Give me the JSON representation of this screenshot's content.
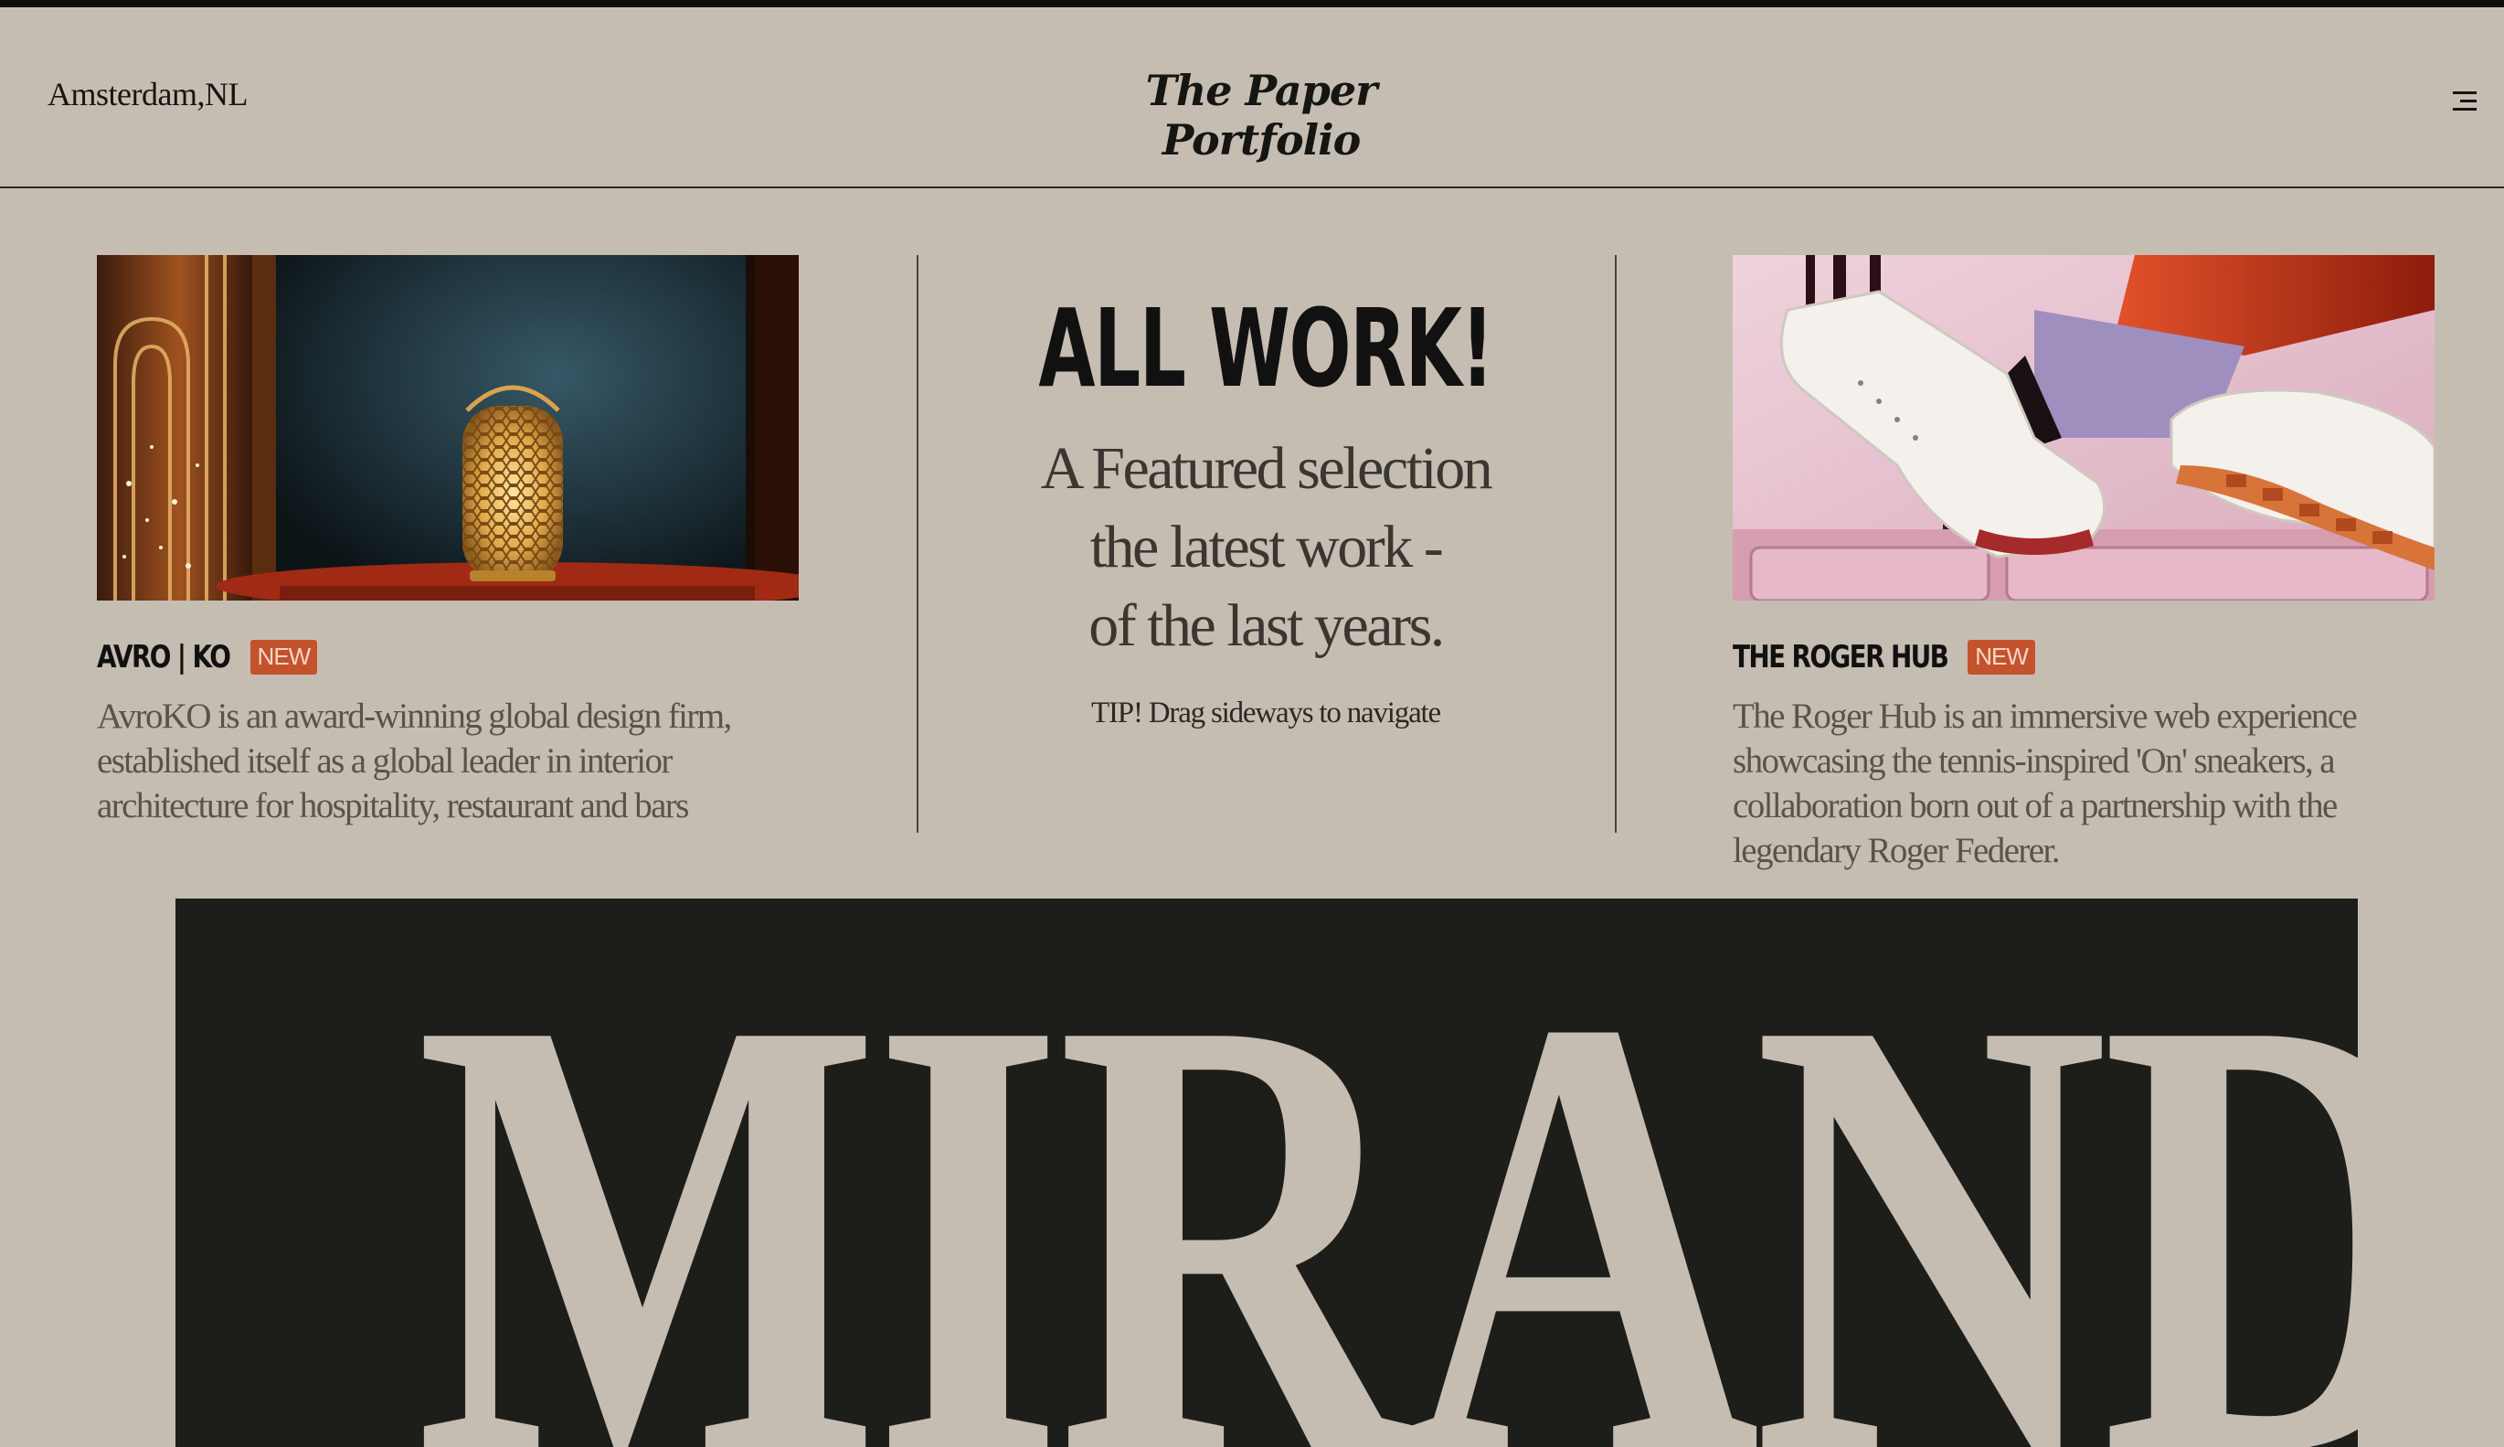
{
  "header": {
    "location": "Amsterdam,NL",
    "site_title": "The Paper Portfolio",
    "menu_icon": "menu-icon"
  },
  "projects": [
    {
      "title": "AVRO | KO",
      "badge": "NEW",
      "description": "AvroKO is an award-winning global design firm, established itself as a global leader in interior architecture for hospitality, restaurant and bars"
    },
    {
      "title": "THE ROGER HUB",
      "badge": "NEW",
      "description": "The Roger Hub is an immersive web experience showcasing the tennis-inspired 'On' sneakers, a collaboration born out of a partnership with the legendary Roger Federer."
    }
  ],
  "intro": {
    "heading": "ALL WORK!",
    "subtitle_lines": [
      "A Featured selection",
      "the latest work -",
      "of the last years."
    ],
    "tip": "TIP! Drag sideways to navigate"
  },
  "banner": {
    "word": "MIRANDA"
  },
  "colors": {
    "background": "#c6bdb2",
    "ink": "#1c1c18",
    "badge": "#c4522c",
    "banner": "#1d1e1a"
  }
}
